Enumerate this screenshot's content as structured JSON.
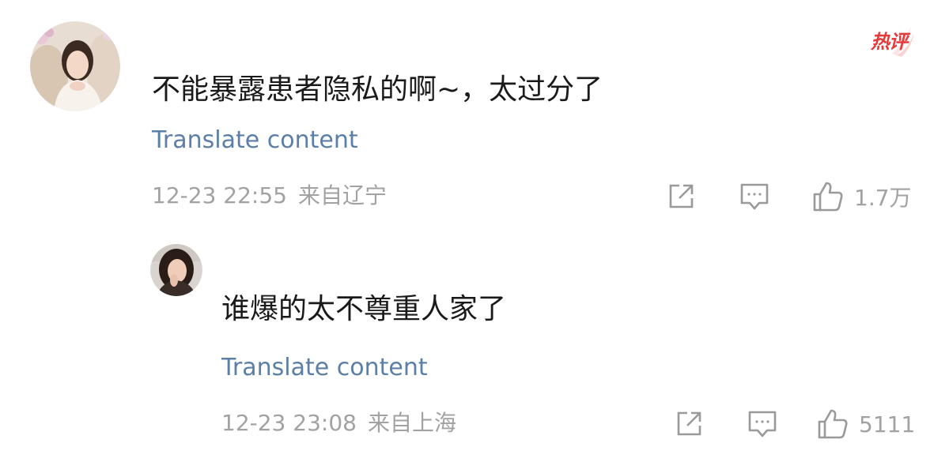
{
  "colors": {
    "text": "#1a1a1a",
    "link": "#5b7fa8",
    "muted": "#a2a2a2",
    "hot": "#e5393a"
  },
  "hot_badge": {
    "label": "热评"
  },
  "comments": [
    {
      "text": "不能暴露患者隐私的啊~，太过分了",
      "translate_label": "Translate content",
      "time": "12-23 22:55",
      "location": "来自辽宁",
      "likes": "1.7万",
      "icons": [
        "share-icon",
        "comment-icon",
        "thumbs-up-icon"
      ]
    },
    {
      "text": "谁爆的太不尊重人家了",
      "translate_label": "Translate content",
      "time": "12-23 23:08",
      "location": "来自上海",
      "likes": "5111",
      "icons": [
        "share-icon",
        "comment-icon",
        "thumbs-up-icon"
      ]
    }
  ]
}
